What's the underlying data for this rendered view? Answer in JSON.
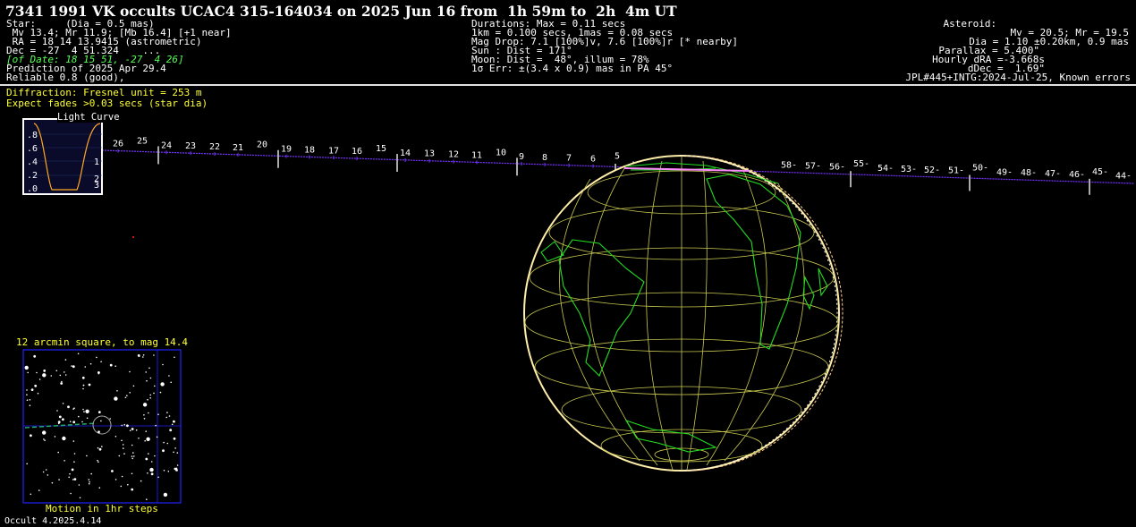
{
  "title": "7341 1991 VK occults UCAC4 315-164034 on 2025 Jun 16 from  1h 59m to  2h  4m UT",
  "star": {
    "lines": [
      "Star:     (Dia = 0.5 mas)",
      " Mv 13.4; Mr 11.9; [Mb 16.4] [+1 near]",
      " RA = 18 14 13.9415 (astrometric)",
      "Dec = -27  4 51.324    ...",
      "Prediction of 2025 Apr 29.4",
      "Reliable 0.8 (good),"
    ],
    "of_date": "[of Date: 18 15 51, -27  4 26]"
  },
  "durations": {
    "lines": [
      "Durations: Max = 0.11 secs",
      "1km = 0.100 secs, 1mas = 0.08 secs",
      "Mag Drop: 7.1 [100%]v, 7.6 [100%]r [* nearby]",
      "Sun : Dist = 171°",
      "Moon: Dist =  48°, illum = 78%",
      "1σ Err: ±(3.4 x 0.9) mas in PA 45°"
    ]
  },
  "asteroid": {
    "lines": [
      "Asteroid:   ",
      "Mv = 20.5; Mr = 19.5",
      "Dia = 1.10 ±0.20km, 0.9 mas",
      "Parallax = 5.400\"",
      "Hourly dRA =-3.668s",
      "dDec =  1.69\"",
      "JPL#445+INTG:2024-Jul-25, Known errors"
    ]
  },
  "diffraction": {
    "line1": "Diffraction: Fresnel unit = 253 m",
    "line2": "Expect fades >0.03 secs (star dia)"
  },
  "light_curve": {
    "title": "Light Curve",
    "y_ticks": [
      ".8",
      ".6",
      ".4",
      ".2",
      ".0"
    ],
    "right_labels": [
      "1",
      "2",
      "3"
    ]
  },
  "track": {
    "left_labels": [
      "26",
      "25",
      "24",
      "23",
      "22",
      "21",
      "20",
      "19",
      "18",
      "17",
      "16",
      "15",
      "14",
      "13",
      "12",
      "11",
      "10",
      "9",
      "8",
      "7",
      "6",
      "5"
    ],
    "right_labels": [
      "58-",
      "57-",
      "56-",
      "55-",
      "54-",
      "53-",
      "52-",
      "51-",
      "50-",
      "49-",
      "48-",
      "47-",
      "46-",
      "45-",
      "44-"
    ]
  },
  "star_chart": {
    "title": "12 arcmin square, to mag 14.4",
    "caption": "Motion in 1hr steps"
  },
  "footer": "Occult 4.2025.4.14",
  "colors": {
    "track": "#7733ff",
    "globe_grid": "#c8c850",
    "coast": "#22dd22",
    "yellow_text": "#ffff33",
    "path_limb": "#ffee99"
  }
}
